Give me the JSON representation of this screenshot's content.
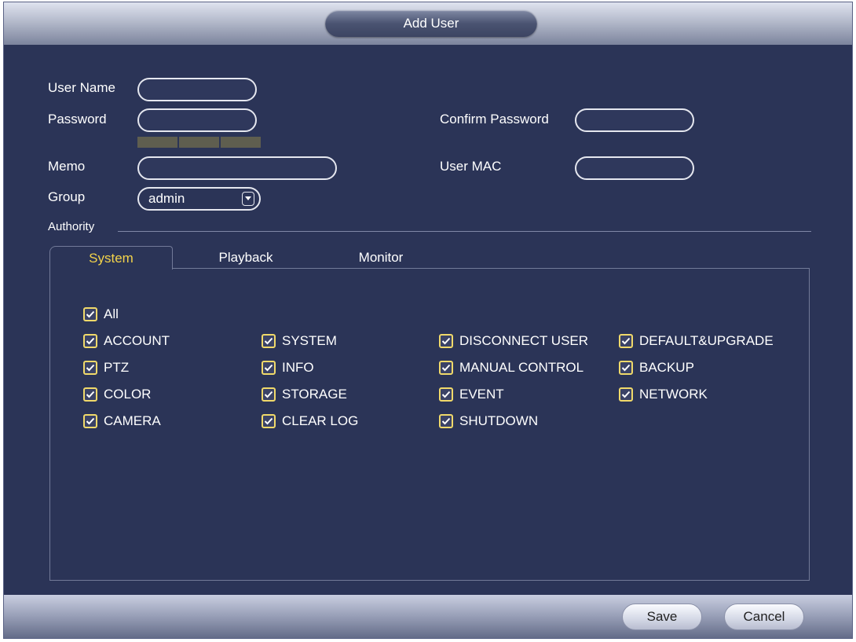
{
  "window": {
    "title": "Add User"
  },
  "form": {
    "user_name_label": "User Name",
    "user_name_value": "",
    "password_label": "Password",
    "password_value": "",
    "confirm_password_label": "Confirm Password",
    "confirm_password_value": "",
    "memo_label": "Memo",
    "memo_value": "",
    "user_mac_label": "User MAC",
    "user_mac_value": "",
    "group_label": "Group",
    "group_value": "admin",
    "authority_label": "Authority"
  },
  "tabs": [
    {
      "label": "System",
      "active": true
    },
    {
      "label": "Playback",
      "active": false
    },
    {
      "label": "Monitor",
      "active": false
    }
  ],
  "permissions": {
    "all": {
      "label": "All",
      "checked": true
    },
    "items": [
      {
        "label": "ACCOUNT",
        "checked": true
      },
      {
        "label": "SYSTEM",
        "checked": true
      },
      {
        "label": "DISCONNECT USER",
        "checked": true
      },
      {
        "label": "DEFAULT&UPGRADE",
        "checked": true
      },
      {
        "label": "PTZ",
        "checked": true
      },
      {
        "label": "INFO",
        "checked": true
      },
      {
        "label": "MANUAL CONTROL",
        "checked": true
      },
      {
        "label": "BACKUP",
        "checked": true
      },
      {
        "label": "COLOR",
        "checked": true
      },
      {
        "label": "STORAGE",
        "checked": true
      },
      {
        "label": "EVENT",
        "checked": true
      },
      {
        "label": "NETWORK",
        "checked": true
      },
      {
        "label": "CAMERA",
        "checked": true
      },
      {
        "label": "CLEAR LOG",
        "checked": true
      },
      {
        "label": "SHUTDOWN",
        "checked": true
      }
    ]
  },
  "footer": {
    "save_label": "Save",
    "cancel_label": "Cancel"
  },
  "colors": {
    "background": "#2b3457",
    "accent_tab": "#f3d34a",
    "checkbox": "#f0d96a"
  },
  "icons": {
    "group_dropdown": "chevron-down-icon",
    "checkbox": "check-icon"
  }
}
